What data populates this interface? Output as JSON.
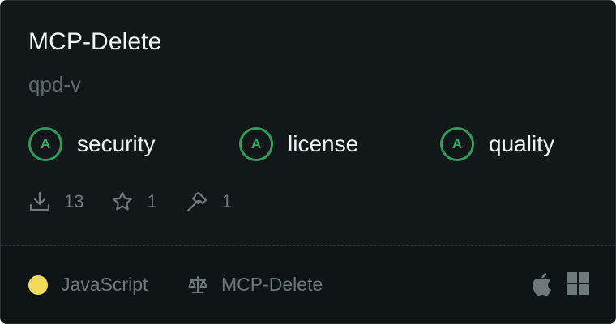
{
  "server": {
    "name": "MCP-Delete",
    "author": "qpd-v"
  },
  "scores": [
    {
      "grade": "A",
      "label": "security"
    },
    {
      "grade": "A",
      "label": "license"
    },
    {
      "grade": "A",
      "label": "quality"
    }
  ],
  "stats": {
    "downloads": "13",
    "stars": "1",
    "tools": "1"
  },
  "footer": {
    "language": "JavaScript",
    "language_color": "#f0da5a",
    "license": "MCP-Delete",
    "platforms": [
      "apple-icon",
      "windows-icon"
    ]
  },
  "colors": {
    "card_bg": "#121719",
    "grade_green": "#2e9d5c",
    "muted_text": "#6e797c"
  }
}
